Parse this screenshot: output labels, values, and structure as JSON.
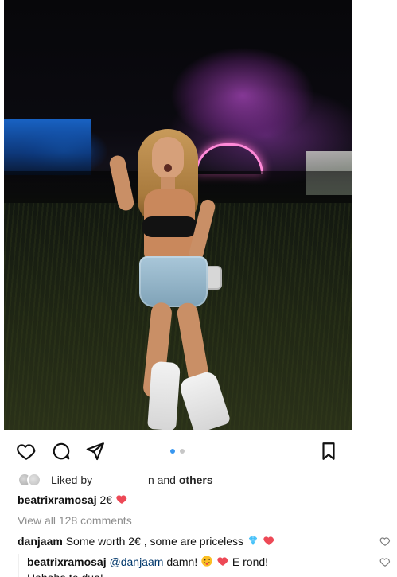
{
  "post": {
    "likes": {
      "prefix": "Liked by",
      "suffix": "n and",
      "others": "others"
    },
    "caption": {
      "username": "beatrixramosaj",
      "text": "2€"
    },
    "view_all_comments": "View all 128 comments",
    "comments": [
      {
        "username": "danjaam",
        "text": "Some worth 2€ , some are priceless"
      }
    ],
    "replies": [
      {
        "username": "beatrixramosaj",
        "mention": "@danjaam",
        "text_before": "damn!",
        "text_after": "E rond!",
        "line2": "Hahaha te dua!"
      }
    ]
  },
  "ui": {
    "icons": {
      "like": "heart-outline-icon",
      "comment": "comment-bubble-icon",
      "share": "paper-plane-icon",
      "save": "bookmark-icon",
      "comment_like": "small-heart-icon",
      "diamond": "diamond-emoji-icon",
      "red_heart": "red-heart-emoji-icon",
      "tongue_face": "tongue-wink-emoji-icon"
    },
    "colors": {
      "accent_blue": "#3897f0",
      "dot_gray": "#c7c7c7",
      "text": "#262626",
      "muted": "#8e8e8e",
      "mention": "#00376b",
      "heart_red": "#ed4956"
    }
  }
}
